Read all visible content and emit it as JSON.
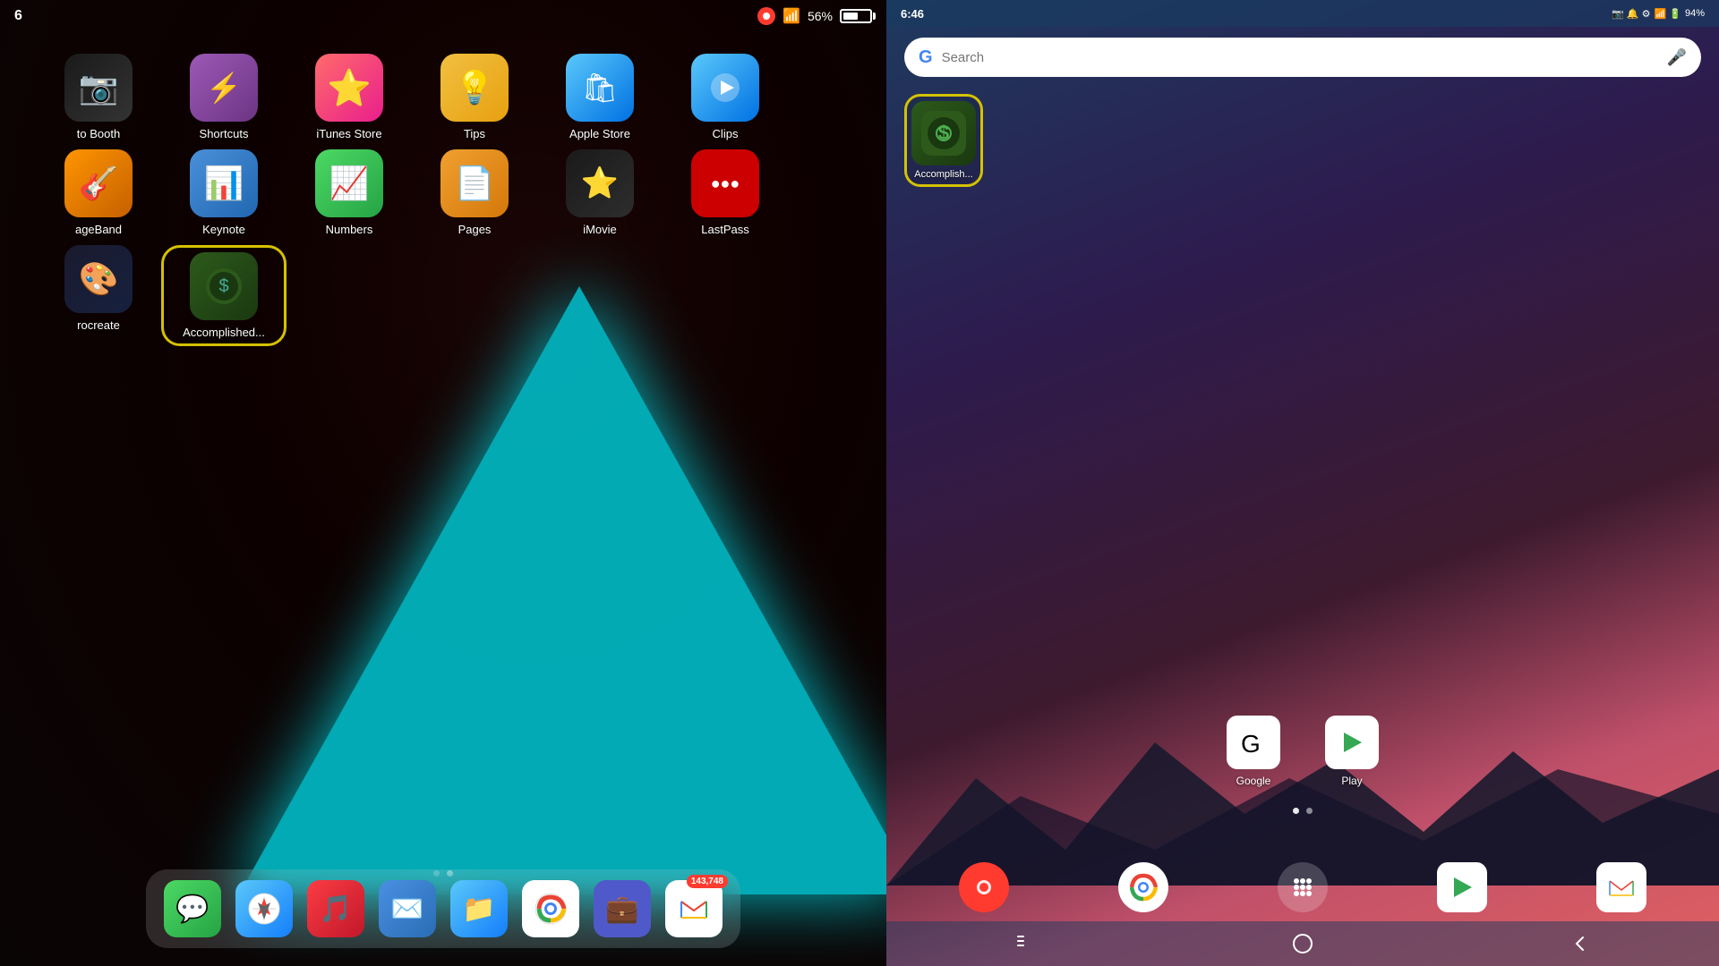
{
  "ipad": {
    "status_bar": {
      "time": "6",
      "battery_percent": "56%",
      "wifi": "wifi"
    },
    "apps_row1": [
      {
        "name": "Photo Booth",
        "label": "to Booth",
        "bg": "bg-photobooth",
        "icon": "📷"
      },
      {
        "name": "Shortcuts",
        "label": "Shortcuts",
        "bg": "bg-shortcuts",
        "icon": "⚡"
      },
      {
        "name": "iTunes Store",
        "label": "iTunes Store",
        "bg": "bg-itunes",
        "icon": "⭐"
      },
      {
        "name": "Tips",
        "label": "Tips",
        "bg": "bg-tips",
        "icon": "💡"
      },
      {
        "name": "Apple Store",
        "label": "Apple Store",
        "bg": "bg-appstore",
        "icon": "🛍"
      },
      {
        "name": "Clips",
        "label": "Clips",
        "bg": "bg-clips",
        "icon": "🎬"
      }
    ],
    "apps_row2": [
      {
        "name": "GarageBand",
        "label": "ageBand",
        "bg": "bg-garageband",
        "icon": "🎸"
      },
      {
        "name": "Keynote",
        "label": "Keynote",
        "bg": "bg-keynote",
        "icon": "📊"
      },
      {
        "name": "Numbers",
        "label": "Numbers",
        "bg": "bg-numbers",
        "icon": "📈"
      },
      {
        "name": "Pages",
        "label": "Pages",
        "bg": "bg-pages",
        "icon": "📄"
      },
      {
        "name": "iMovie",
        "label": "iMovie",
        "bg": "bg-imovie",
        "icon": "🎬"
      },
      {
        "name": "LastPass",
        "label": "LastPass",
        "bg": "bg-lastpass",
        "icon": "🔑"
      }
    ],
    "apps_row3": [
      {
        "name": "Procreate",
        "label": "rocreate",
        "bg": "bg-procreate",
        "icon": "🎨"
      },
      {
        "name": "Accomplished",
        "label": "Accomplished...",
        "bg": "bg-accomplished",
        "icon": "✅",
        "highlighted": true
      }
    ],
    "dock": [
      {
        "name": "Messages",
        "label": "Messages",
        "bg": "bg-messages",
        "icon": "💬"
      },
      {
        "name": "Safari",
        "label": "Safari",
        "bg": "bg-safari",
        "icon": "🧭"
      },
      {
        "name": "Music",
        "label": "Music",
        "bg": "bg-music",
        "icon": "🎵"
      },
      {
        "name": "Mail",
        "label": "Mail",
        "bg": "bg-mail",
        "icon": "✉️"
      },
      {
        "name": "Files",
        "label": "Files",
        "bg": "bg-files",
        "icon": "📁"
      },
      {
        "name": "Chrome",
        "label": "Chrome",
        "bg": "bg-chrome",
        "icon": "🌐"
      },
      {
        "name": "Teams",
        "label": "Teams",
        "bg": "bg-teams",
        "icon": "💼"
      },
      {
        "name": "Gmail",
        "label": "Gmail",
        "bg": "bg-gmail",
        "icon": "📧",
        "badge": "143,748"
      }
    ]
  },
  "android": {
    "status_bar": {
      "time": "6:46",
      "battery_percent": "94%",
      "icons": "📶🔋"
    },
    "search_placeholder": "Search",
    "accomplished_label": "Accomplish...",
    "apps": [
      {
        "name": "Google",
        "label": "Google",
        "bg": "#fff",
        "icon": "G"
      },
      {
        "name": "Play",
        "label": "Play",
        "bg": "#fff",
        "icon": "▶"
      }
    ],
    "dock_icons": [
      {
        "name": "Screen Recorder",
        "icon": "🔴",
        "bg": "#ff3b30"
      },
      {
        "name": "Chrome",
        "icon": "🌐",
        "bg": "#fff"
      },
      {
        "name": "App Drawer",
        "icon": "⋯",
        "bg": "rgba(255,255,255,0.2)"
      },
      {
        "name": "Play Store",
        "icon": "▶",
        "bg": "#fff"
      },
      {
        "name": "Gmail",
        "icon": "M",
        "bg": "#fff"
      }
    ],
    "nav": {
      "back": "‹",
      "home": "○",
      "recents": "|||"
    }
  }
}
